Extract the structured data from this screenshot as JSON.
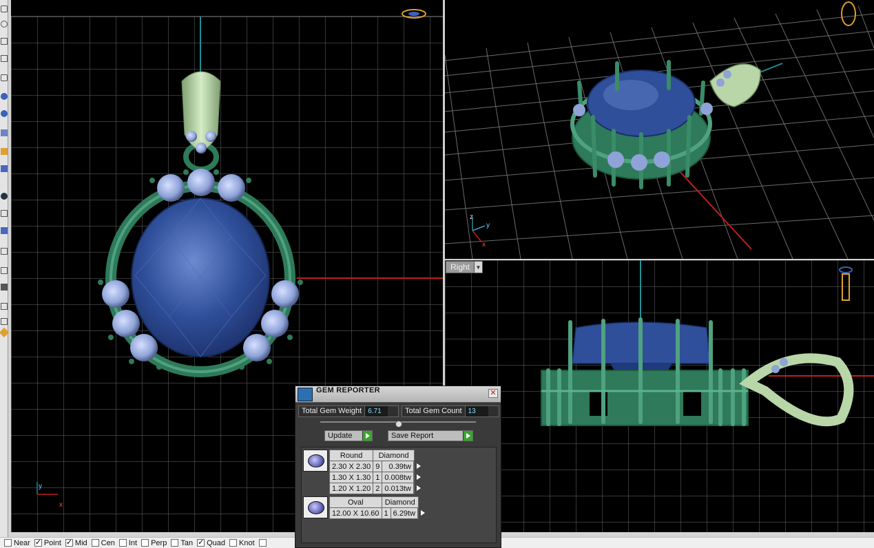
{
  "viewports": {
    "right_label": "Right"
  },
  "osnap": {
    "items": [
      {
        "label": "Near",
        "checked": false
      },
      {
        "label": "Point",
        "checked": true
      },
      {
        "label": "Mid",
        "checked": true
      },
      {
        "label": "Cen",
        "checked": false
      },
      {
        "label": "Int",
        "checked": false
      },
      {
        "label": "Perp",
        "checked": false
      },
      {
        "label": "Tan",
        "checked": false
      },
      {
        "label": "Quad",
        "checked": true
      },
      {
        "label": "Knot",
        "checked": false
      }
    ]
  },
  "gem_reporter": {
    "title": "GEM REPORTER",
    "total_weight_label": "Total Gem Weight",
    "total_weight_value": "6.71",
    "total_count_label": "Total Gem Count",
    "total_count_value": "13",
    "update_label": "Update",
    "save_report_label": "Save Report",
    "groups": [
      {
        "shape": "Round",
        "material": "Diamond",
        "rows": [
          {
            "size": "2.30 X 2.30",
            "qty": "9",
            "tw": "0.39tw"
          },
          {
            "size": "1.30 X 1.30",
            "qty": "1",
            "tw": "0.008tw"
          },
          {
            "size": "1.20 X 1.20",
            "qty": "2",
            "tw": "0.013tw"
          }
        ]
      },
      {
        "shape": "Oval",
        "material": "Diamond",
        "rows": [
          {
            "size": "12.00 X 10.60",
            "qty": "1",
            "tw": "6.29tw"
          }
        ]
      }
    ]
  },
  "axes": {
    "front_y": "y",
    "front_x": "x",
    "persp_z": "z",
    "persp_y": "y",
    "persp_x": "x"
  },
  "colors": {
    "gem_blue": "#2f4f9a",
    "metal_green": "#2e7a5a",
    "bail_green": "#b9d6a8",
    "accent_diamond": "#8fa3d8",
    "axis_red": "#c0201c",
    "axis_teal": "#1c8f98",
    "grid": "#7a7a7a"
  }
}
